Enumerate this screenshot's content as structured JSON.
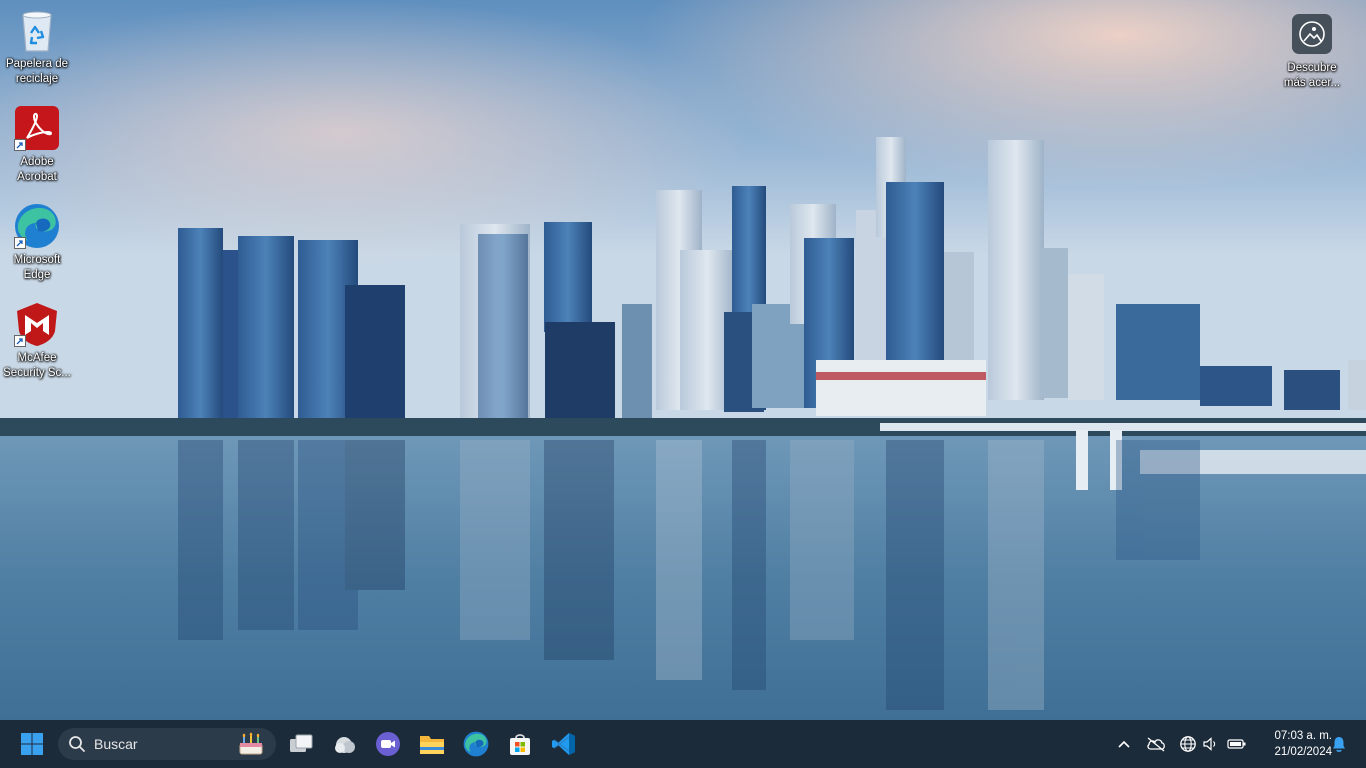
{
  "desktop": {
    "icons": [
      {
        "label": "Papelera de reciclaje",
        "icon": "recycle-bin-icon"
      },
      {
        "label": "Adobe Acrobat",
        "icon": "adobe-acrobat-icon"
      },
      {
        "label": "Microsoft Edge",
        "icon": "edge-icon"
      },
      {
        "label": "McAfee Security Sc...",
        "icon": "mcafee-icon"
      }
    ],
    "spotlight": {
      "label": "Descubre más acer...",
      "icon": "spotlight-icon"
    }
  },
  "taskbar": {
    "search_placeholder": "Buscar",
    "pinned": [
      "start-icon",
      "task-view-icon",
      "widgets-icon",
      "teams-chat-icon",
      "file-explorer-icon",
      "edge-icon",
      "store-icon",
      "vscode-icon"
    ],
    "clock": {
      "time": "07:03 a. m.",
      "date": "21/02/2024"
    },
    "tray": [
      "chevron-up-icon",
      "onedrive-offline-icon",
      "language-globe-icon",
      "volume-icon",
      "battery-icon",
      "notification-bell-icon"
    ]
  },
  "colors": {
    "taskbar": "#1c2b3a",
    "search": "#2c3b4a",
    "accent": "#0078d4"
  }
}
